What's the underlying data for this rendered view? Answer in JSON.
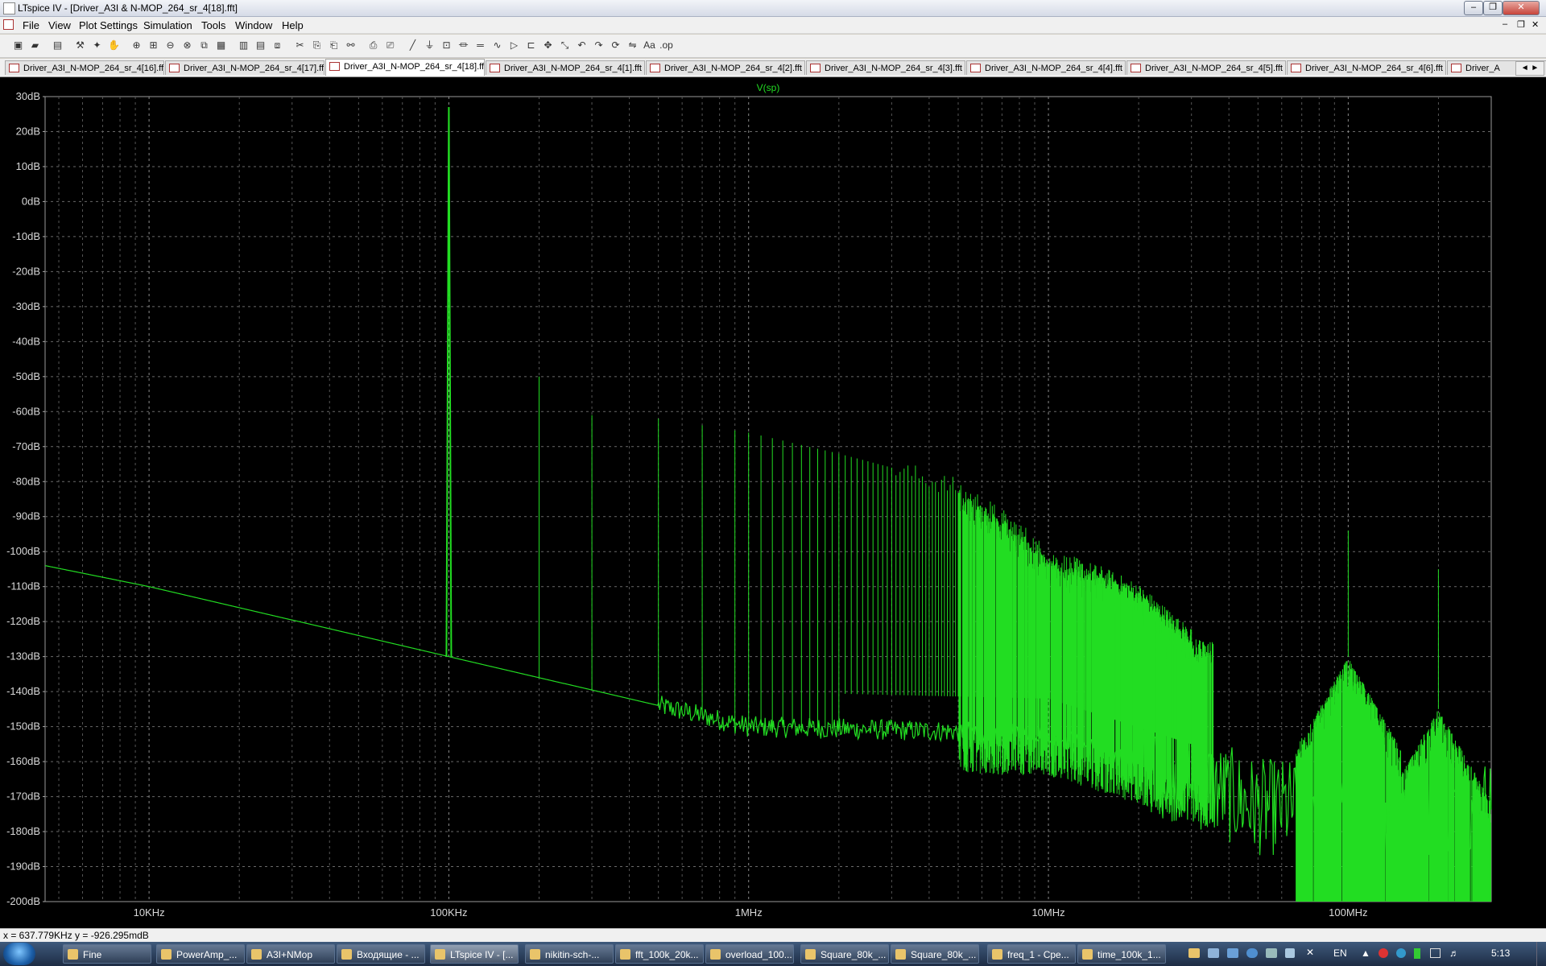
{
  "window": {
    "title": "LTspice IV - [Driver_A3I & N-MOP_264_sr_4[18].fft]"
  },
  "menu": [
    "File",
    "View",
    "Plot Settings",
    "Simulation",
    "Tools",
    "Window",
    "Help"
  ],
  "toolbar_icons": [
    "new-schematic-icon",
    "open-icon",
    "save-icon",
    "control-panel-icon",
    "run-icon",
    "halt-icon",
    "zoom-in-icon",
    "zoom-area-icon",
    "zoom-out-icon",
    "zoom-fit-icon",
    "autorange-icon",
    "grid-icon",
    "tile-horizontal-icon",
    "tile-vertical-icon",
    "cascade-icon",
    "cut-icon",
    "copy-icon",
    "paste-icon",
    "find-icon",
    "print-preview-icon",
    "print-icon",
    "wire-icon",
    "ground-icon",
    "label-icon",
    "resistor-icon",
    "capacitor-icon",
    "inductor-icon",
    "diode-icon",
    "component-icon",
    "move-icon",
    "drag-icon",
    "undo-icon",
    "redo-icon",
    "rotate-icon",
    "mirror-icon",
    "text-icon",
    "spice-directive-icon"
  ],
  "tabs": [
    {
      "label": "Driver_A3I_N-MOP_264_sr_4[16].fft",
      "active": false
    },
    {
      "label": "Driver_A3I_N-MOP_264_sr_4[17].fft",
      "active": false
    },
    {
      "label": "Driver_A3I_N-MOP_264_sr_4[18].fft",
      "active": true
    },
    {
      "label": "Driver_A3I_N-MOP_264_sr_4[1].fft",
      "active": false
    },
    {
      "label": "Driver_A3I_N-MOP_264_sr_4[2].fft",
      "active": false
    },
    {
      "label": "Driver_A3I_N-MOP_264_sr_4[3].fft",
      "active": false
    },
    {
      "label": "Driver_A3I_N-MOP_264_sr_4[4].fft",
      "active": false
    },
    {
      "label": "Driver_A3I_N-MOP_264_sr_4[5].fft",
      "active": false
    },
    {
      "label": "Driver_A3I_N-MOP_264_sr_4[6].fft",
      "active": false
    },
    {
      "label": "Driver_A",
      "active": false
    }
  ],
  "chart_data": {
    "type": "line",
    "title": "V(sp)",
    "trace_color": "#22dd22",
    "grid": true,
    "x_scale": "log",
    "xlim_hz": [
      4500,
      300000000
    ],
    "ylim_db": [
      -200,
      30
    ],
    "y_ticks": [
      "30dB",
      "20dB",
      "10dB",
      "0dB",
      "-10dB",
      "-20dB",
      "-30dB",
      "-40dB",
      "-50dB",
      "-60dB",
      "-70dB",
      "-80dB",
      "-90dB",
      "-100dB",
      "-110dB",
      "-120dB",
      "-130dB",
      "-140dB",
      "-150dB",
      "-160dB",
      "-170dB",
      "-180dB",
      "-190dB",
      "-200dB"
    ],
    "x_ticks": [
      {
        "label": "10KHz",
        "hz": 10000
      },
      {
        "label": "100KHz",
        "hz": 100000
      },
      {
        "label": "1MHz",
        "hz": 1000000
      },
      {
        "label": "10MHz",
        "hz": 10000000
      },
      {
        "label": "100MHz",
        "hz": 100000000
      }
    ],
    "fundamental": {
      "hz": 100000,
      "db": 27
    },
    "noise_floor": [
      [
        4500,
        -104
      ],
      [
        10000,
        -110
      ],
      [
        100000,
        -130
      ],
      [
        1000000,
        -150
      ],
      [
        10000000,
        -152
      ],
      [
        30000000,
        -165
      ],
      [
        50000000,
        -173
      ]
    ],
    "harmonic_envelope": [
      [
        200000,
        -50
      ],
      [
        300000,
        -61
      ],
      [
        400000,
        -62
      ],
      [
        500000,
        -62
      ],
      [
        1000000,
        -66
      ],
      [
        2000000,
        -72
      ],
      [
        3000000,
        -76
      ],
      [
        5000000,
        -82
      ],
      [
        8000000,
        -94
      ],
      [
        10000000,
        -102
      ],
      [
        15000000,
        -107
      ],
      [
        20000000,
        -112
      ],
      [
        30000000,
        -125
      ]
    ],
    "sidebands": [
      {
        "hz": 100000000,
        "db": -130,
        "spike_db": -94
      },
      {
        "hz": 200000000,
        "db": -145,
        "spike_db": -105
      }
    ]
  },
  "status": {
    "readout": "x = 637.779KHz   y = -926.295mdB"
  },
  "taskbar": {
    "items": [
      {
        "label": "Fine",
        "active": false
      },
      {
        "label": "PowerAmp_...",
        "active": false
      },
      {
        "label": "A3I+NMop",
        "active": false
      },
      {
        "label": "Входящие - ...",
        "active": false
      },
      {
        "label": "LTspice IV - [...",
        "active": true
      },
      {
        "label": "nikitin-sch-...",
        "active": false
      },
      {
        "label": "fft_100k_20k...",
        "active": false
      },
      {
        "label": "overload_100...",
        "active": false
      },
      {
        "label": "Square_80k_...",
        "active": false
      },
      {
        "label": "Square_80k_...",
        "active": false
      },
      {
        "label": "freq_1 - Сре...",
        "active": false
      },
      {
        "label": "time_100k_1...",
        "active": false
      }
    ],
    "lang": "EN",
    "clock": "5:13"
  }
}
